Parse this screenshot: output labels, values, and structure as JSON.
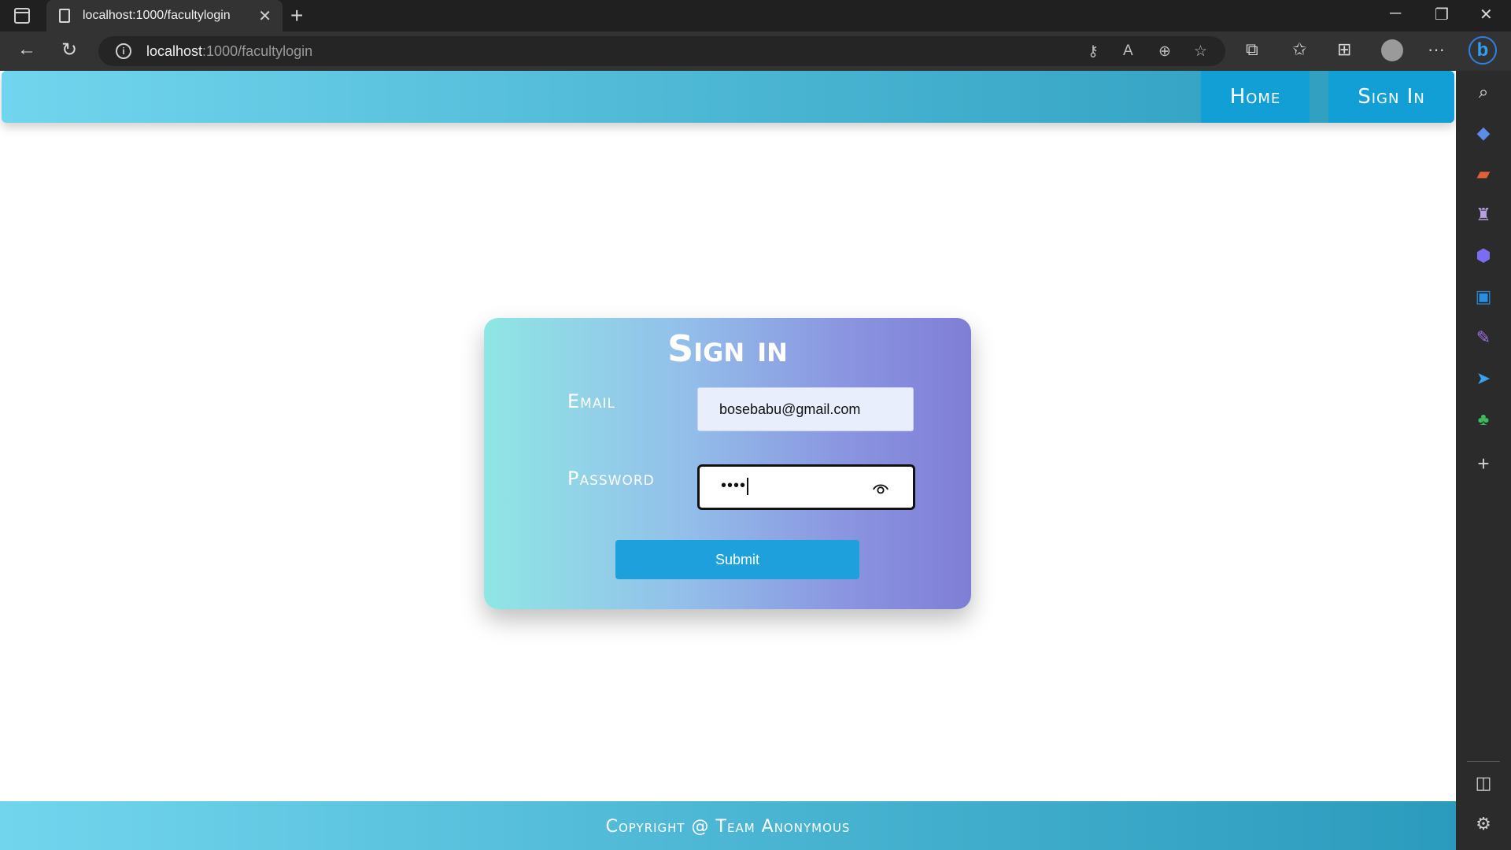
{
  "browser": {
    "tab_title": "localhost:1000/facultylogin",
    "url_host": "localhost",
    "url_path": ":1000/facultylogin",
    "close_glyph": "✕",
    "new_tab_glyph": "+",
    "minimize_glyph": "─",
    "restore_glyph": "❐",
    "window_close_glyph": "✕",
    "back_glyph": "←",
    "reload_glyph": "↻",
    "more_glyph": "···",
    "bing_glyph": "b"
  },
  "navbar": {
    "links": [
      {
        "label": "Home"
      },
      {
        "label": "Sign In"
      }
    ]
  },
  "signin_card": {
    "title": "Sign in",
    "email_label": "Email",
    "email_value": "bosebabu@gmail.com",
    "password_label": "Password",
    "password_value": "••••",
    "submit_label": "Submit"
  },
  "footer": {
    "text": "Copyright @ Team Anonymous"
  },
  "colors": {
    "navbar_gradient_start": "#72d5ee",
    "navbar_gradient_end": "#2b9bbd",
    "nav_button": "#129fd6",
    "card_gradient_start": "#8fe6e4",
    "card_gradient_end": "#7f7ed6",
    "submit_button": "#1ea0dc"
  },
  "sidebar_icons": [
    "search-icon",
    "tag-icon",
    "briefcase-icon",
    "chess-icon",
    "copilot-icon",
    "outlook-icon",
    "edit-icon",
    "send-icon",
    "tree-icon",
    "add-icon",
    "split-view-icon",
    "settings-icon"
  ]
}
